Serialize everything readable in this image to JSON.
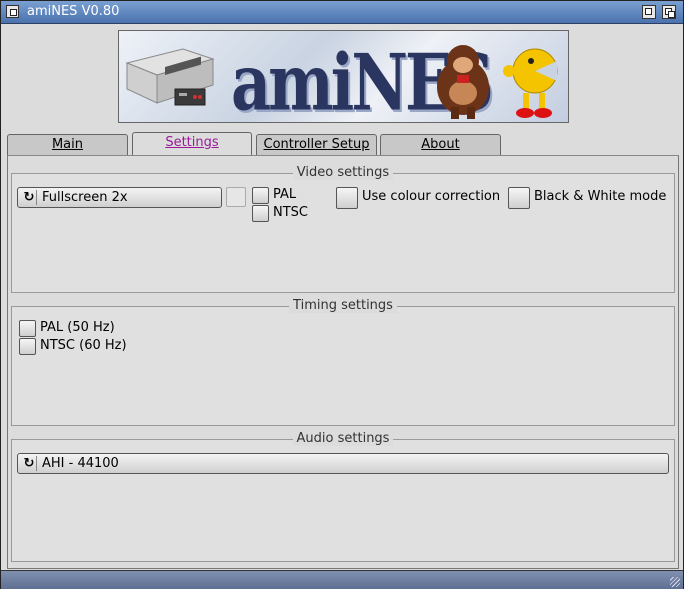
{
  "window": {
    "title": "amiNES V0.80"
  },
  "tabs": [
    {
      "label": "Main",
      "active": false
    },
    {
      "label": "Settings",
      "active": true
    },
    {
      "label": "Controller Setup",
      "active": false
    },
    {
      "label": "About",
      "active": false
    }
  ],
  "video": {
    "title": "Video settings",
    "mode_value": "Fullscreen 2x",
    "pal_label": "PAL",
    "ntsc_label": "NTSC",
    "colour_correction_label": "Use colour correction",
    "bw_mode_label": "Black & White mode"
  },
  "timing": {
    "title": "Timing settings",
    "pal_label": "PAL (50 Hz)",
    "ntsc_label": "NTSC (60 Hz)"
  },
  "audio": {
    "title": "Audio settings",
    "mode_value": "AHI - 44100"
  },
  "banner": {
    "logo_text": "amiNES"
  },
  "colors": {
    "titlebar": "#5a80bc",
    "accent_tab": "#9a1a9a",
    "statusbar": "#6b7ca0"
  }
}
